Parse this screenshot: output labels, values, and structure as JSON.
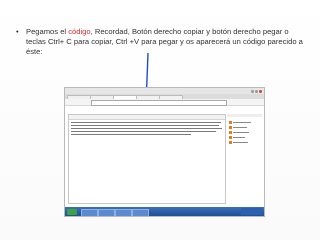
{
  "instruction": {
    "part1": "Pegamos el ",
    "keyword": "código",
    "part2": ", Recordad, Botón derecho copiar y botón derecho pegar o teclas Ctrl+ C para copiar, Ctrl +V para pegar y os aparecerá un código parecido a éste:"
  },
  "colors": {
    "keyword": "#d03030",
    "arrow": "#1f4fbf"
  },
  "icons": {
    "bullet": "bullet-dot-icon",
    "arrow": "arrow-down-icon"
  }
}
